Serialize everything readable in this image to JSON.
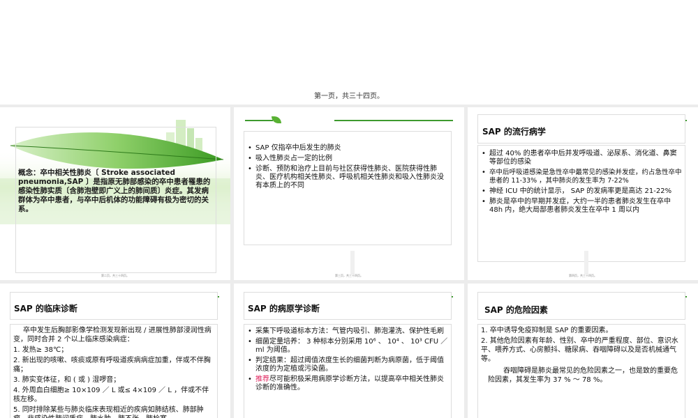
{
  "top": {
    "caption": "第一页，共三十四页。"
  },
  "slide1": {
    "definition": "概念：卒中相关性肺炎〔 Stroke associated pneumonia,SAP 〕是指原无肺部感染的卒中患者罹患的感染性肺实质〔含肺泡壁即广义上的肺间质〕炎症。其发病群体为卒中患者，与卒中后机体的功能障碍有极为密切的关系。",
    "footer": "第二页，共三十四页。"
  },
  "slide2": {
    "bullets": [
      "SAP 仅指卒中后发生的肺炎",
      "吸入性肺炎占一定的比例",
      "诊断、预防和治疗上目前与社区获得性肺炎、医院获得性肺炎、医疗机构相关性肺炎、呼吸机相关性肺炎和吸入性肺炎没有本质上的不同"
    ],
    "footer": "第三页，共三十四页。"
  },
  "slide3": {
    "title": "SAP 的流行病学",
    "bullets": [
      "超过 40% 的患者卒中后并发呼吸道、泌尿系、消化道、鼻窦等部位的感染",
      "卒中后呼吸道感染是急性卒中最常见的感染并发症，约占急性卒中患者的 11-33% ，其中肺炎的发生率为 7-22%",
      "神经 ICU 中的统计显示，  SAP 的发病率更是高达 21-22%",
      "肺炎是卒中的早期并发症，大约一半的患者肺炎发生在卒中 48h 内，绝大局部患者肺炎发生在卒中 1 周以内"
    ],
    "footer": "第四页，共三十四页。"
  },
  "slide4": {
    "title": "SAP 的临床诊断",
    "intro": "卒中发生后胸部影像学检测发现新出现 / 进展性肺部浸润性病变，同时合并 2 个以上临床感染病症：",
    "items": [
      "1. 发热≥ 38℃；",
      "2. 新出现的咳嗽、咳痰或原有呼吸道疾病病症加重，伴或不伴胸痛；",
      "3. 肺实变体征，和 ( 或 ) 湿啰音；",
      "4. 外周血白细胞≥ 10×109 ／ L 或≤ 4×109 ／ L ，伴或不伴核左移。",
      "5. 同时排除某些与肺炎临床表现相近的疾病如肺结核、肺部肿瘤、非感染性肺间质病、肺水肿、肺不张、肺栓塞"
    ]
  },
  "slide5": {
    "title": "SAP 的病原学诊断",
    "bullets": [
      {
        "text": "采集下呼吸道标本方法：气管内吸引、肺泡灌洗、保护性毛刷",
        "highlight": ""
      },
      {
        "text": "细菌定量培养： 3 种标本分别采用 10⁶ 、 10⁴ 、 10³ CFU ／ ml 为阈值。",
        "highlight": ""
      },
      {
        "text": "判定结果：超过阈值浓度生长的细菌判断为病原菌，低于阈值浓度的为定植或污染菌。",
        "highlight": ""
      },
      {
        "text": "尽可能积极采用病原学诊断方法，以提高卒中相关性肺炎诊断的准确性。",
        "highlight": "推荐"
      }
    ]
  },
  "slide6": {
    "title": "SAP 的危险因素",
    "items": [
      "1. 卒中诱导免疫抑制是 SAP 的重要因素。",
      "2. 其他危险因素有年龄、性别、卒中的严重程度、部位、意识水平、喂养方式、心房颤抖、糖尿病、吞咽障碍以及是否机械通气等。"
    ],
    "paragraph": "吞咽障碍是肺炎最常见的危险因素之一，也是致的重要危险因素，其发生率为 37 % ～ 78 %。"
  }
}
